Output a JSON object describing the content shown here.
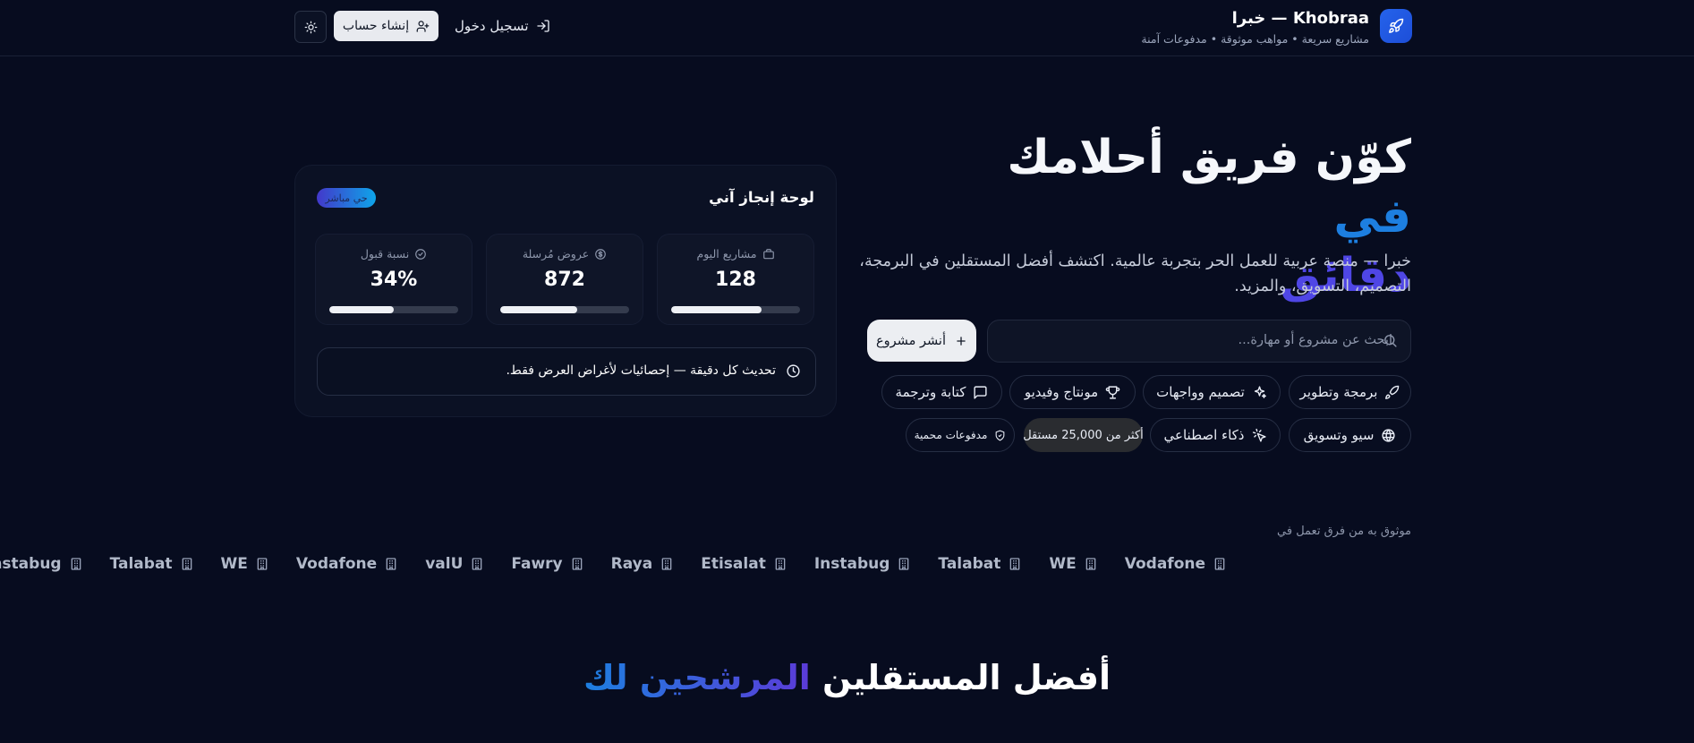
{
  "header": {
    "brand_name": "Khobraa — خبرا",
    "brand_tagline": "مشاريع سريعة • مواهب موثوقة • مدفوعات آمنة",
    "login_label": "تسجيل دخول",
    "signup_label": "إنشاء حساب"
  },
  "hero": {
    "title_main": "كوّن فريق أحلامك ",
    "title_accent_1": "في",
    "title_accent_2": "دقائق",
    "description": "خبرا — منصة عربية للعمل الحر بتجربة عالمية. اكتشف أفضل المستقلين في البرمجة، التصميم، التسويق، والمزيد.",
    "search_placeholder": "ابحث عن مشروع أو مهارة...",
    "post_project_label": "أنشر مشروع",
    "categories": [
      {
        "label": "برمجة وتطوير",
        "icon": "rocket-icon"
      },
      {
        "label": "تصميم وواجهات",
        "icon": "sparkles-icon"
      },
      {
        "label": "مونتاج وفيديو",
        "icon": "trophy-icon"
      },
      {
        "label": "كتابة وترجمة",
        "icon": "message-icon"
      },
      {
        "label": "سيو وتسويق",
        "icon": "globe-icon"
      },
      {
        "label": "ذكاء اصطناعي",
        "icon": "cursor-click-icon"
      }
    ],
    "freelancers_badge": "أكثر من 25,000 مستقل",
    "local_payments_badge": "مدفوعات محمية"
  },
  "dashboard": {
    "title": "لوحة إنجاز آني",
    "live_badge": "حي مباشر",
    "stats": [
      {
        "label": "مشاريع اليوم",
        "value": "128",
        "icon": "briefcase-icon",
        "progress": 0.7
      },
      {
        "label": "عروض مُرسلة",
        "value": "872",
        "icon": "dollar-icon",
        "progress": 0.6
      },
      {
        "label": "نسبة قبول",
        "value": "34%",
        "icon": "check-circle-icon",
        "progress": 0.5
      }
    ],
    "update_note": "تحديث كل دقيقة — إحصائيات لأغراض العرض فقط."
  },
  "trusted": {
    "label": "موثوق به من فرق تعمل في",
    "logos": [
      "Vodafone",
      "WE",
      "Talabat",
      "Instabug",
      "Etisalat",
      "Raya",
      "Fawry",
      "valU",
      "Vodafone",
      "WE",
      "Talabat",
      "Instabug"
    ]
  },
  "section": {
    "title_main": "أفضل المستقلين ",
    "title_accent": "المرشحين لك"
  },
  "colors": {
    "background": "#070c1f",
    "accent_blue": "#1d7fe0",
    "accent_purple": "#4f46e5"
  }
}
